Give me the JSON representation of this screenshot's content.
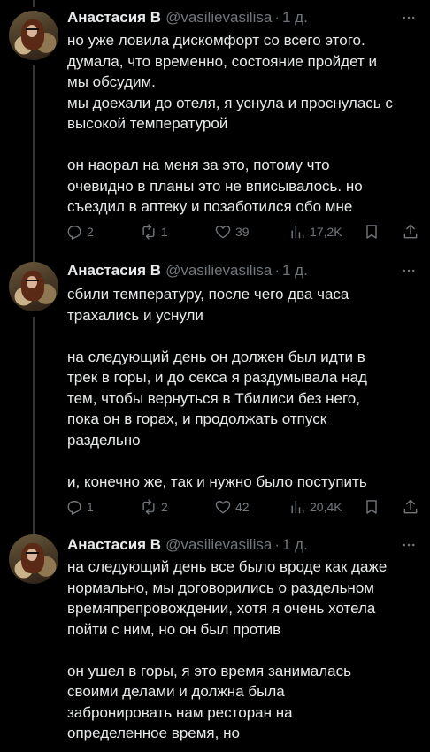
{
  "author": {
    "name": "Анастасия B",
    "handle": "@vasilievasilisa",
    "separator": "·",
    "time": "1 д."
  },
  "tweets": [
    {
      "text": "но уже ловила дискомфорт со всего этого.\nдумала, что временно, состояние пройдет и\nмы обсудим.\nмы доехали до отеля, я уснула и проснулась с\nвысокой температурой\n\nон наорал на меня за это, потому что\nочевидно в планы это не вписывалось. но\nсъездил в аптеку и позаботился обо мне",
      "replies": "2",
      "retweets": "1",
      "likes": "39",
      "views": "17,2K"
    },
    {
      "text": "сбили температуру, после чего два часа\nтрахались и уснули\n\nна следующий день он должен был идти в\nтрек в горы, и до секса я раздумывала над\nтем, чтобы вернуться в Тбилиси без него,\nпока он в горах, и продолжать отпуск\nраздельно\n\nи, конечно же, так и нужно было поступить",
      "replies": "1",
      "retweets": "2",
      "likes": "42",
      "views": "20,4K"
    },
    {
      "text": "на следующий день все было вроде как даже\nнормально, мы договорились о раздельном\nвремяпрепровождении, хотя я очень хотела\nпойти с ним, но он был против\n\nон ушел в горы, я это время занималась\nсвоими делами и должна была\nзабронировать нам ресторан на\nопределенное время, но"
    }
  ],
  "icons": {
    "more": "more-horizontal-icon",
    "reply": "reply-icon",
    "retweet": "retweet-icon",
    "like": "heart-icon",
    "views": "views-icon",
    "bookmark": "bookmark-icon",
    "share": "share-icon"
  },
  "colors": {
    "background": "#000000",
    "text": "#e7e9ea",
    "secondary": "#71767b",
    "thread_line": "#333639"
  }
}
